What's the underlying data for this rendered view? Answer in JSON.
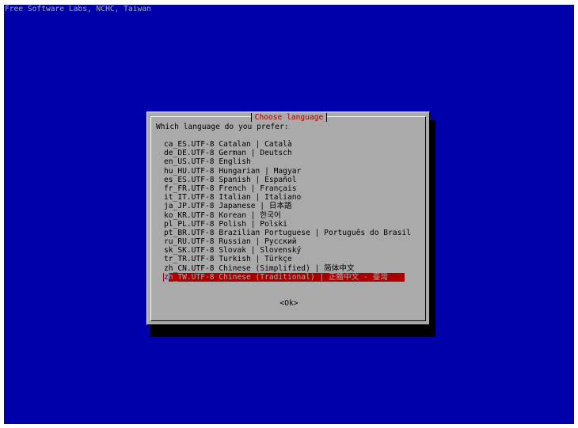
{
  "backtitle": "Free Software Labs, NCHC, Taiwan",
  "dialog": {
    "title": "Choose language",
    "prompt": "Which language do you prefer:",
    "ok_label": "<Ok>"
  },
  "languages": [
    {
      "code": "ca_ES.UTF-8",
      "name": "Catalan | Català"
    },
    {
      "code": "de_DE.UTF-8",
      "name": "German | Deutsch"
    },
    {
      "code": "en_US.UTF-8",
      "name": "English"
    },
    {
      "code": "hu_HU.UTF-8",
      "name": "Hungarian | Magyar"
    },
    {
      "code": "es_ES.UTF-8",
      "name": "Spanish | Español"
    },
    {
      "code": "fr_FR.UTF-8",
      "name": "French | Français"
    },
    {
      "code": "it_IT.UTF-8",
      "name": "Italian | Italiano"
    },
    {
      "code": "ja_JP.UTF-8",
      "name": "Japanese | 日本語"
    },
    {
      "code": "ko_KR.UTF-8",
      "name": "Korean | 한국어"
    },
    {
      "code": "pl_PL.UTF-8",
      "name": "Polish | Polski"
    },
    {
      "code": "pt_BR.UTF-8",
      "name": "Brazilian Portuguese | Português do Brasil"
    },
    {
      "code": "ru_RU.UTF-8",
      "name": "Russian | Русский"
    },
    {
      "code": "sk_SK.UTF-8",
      "name": "Slovak | Slovenský"
    },
    {
      "code": "tr_TR.UTF-8",
      "name": "Turkish | Türkçe"
    },
    {
      "code": "zh_CN.UTF-8",
      "name": "Chinese (Simplified) | 简体中文"
    },
    {
      "code": "zh_TW.UTF-8",
      "name": "Chinese (Traditional) | 正體中文 - 臺灣"
    }
  ],
  "selected_index": 15,
  "colors": {
    "screen_bg": "#0000aa",
    "dialog_bg": "#aaaaaa",
    "title_fg": "#aa0000",
    "highlight_bg": "#aa0000",
    "highlight_fg": "#aaaaaa"
  }
}
